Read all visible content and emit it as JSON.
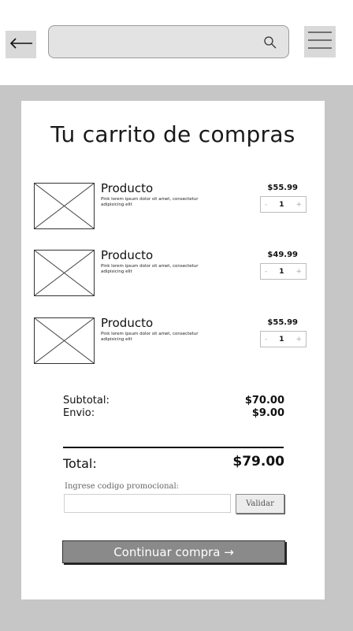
{
  "header": {
    "back_icon": "left-arrow-icon",
    "search": {
      "placeholder": "",
      "value": "",
      "icon": "search-icon"
    },
    "menu_icon": "hamburger-menu-icon"
  },
  "cart": {
    "title": "Tu carrito de compras",
    "items": [
      {
        "name": "Producto",
        "description": "Pink lorem ipsum dolor sit amet, consectetur adipisicing elit",
        "price": "$55.99",
        "qty": "1",
        "minus": "-",
        "plus": "+"
      },
      {
        "name": "Producto",
        "description": "Pink lorem ipsum dolor sit amet, consectetur adipisicing elit",
        "price": "$49.99",
        "qty": "1",
        "minus": "-",
        "plus": "+"
      },
      {
        "name": "Producto",
        "description": "Pink lorem ipsum dolor sit amet, consectetur adipisicing elit",
        "price": "$55.99",
        "qty": "1",
        "minus": "-",
        "plus": "+"
      }
    ],
    "summary": {
      "subtotal_label": "Subtotal:",
      "subtotal_value": "$70.00",
      "shipping_label": "Envio:",
      "shipping_value": "$9.00",
      "total_label": "Total:",
      "total_value": "$79.00"
    },
    "promo": {
      "label": "Ingrese codigo promocional:",
      "placeholder": "",
      "button": "Validar"
    },
    "continue_button": "Continuar  compra →"
  },
  "colors": {
    "backdrop": "#c6c6c6",
    "button_fill": "#8a8a8a",
    "control_fill": "#d9d9d9"
  }
}
